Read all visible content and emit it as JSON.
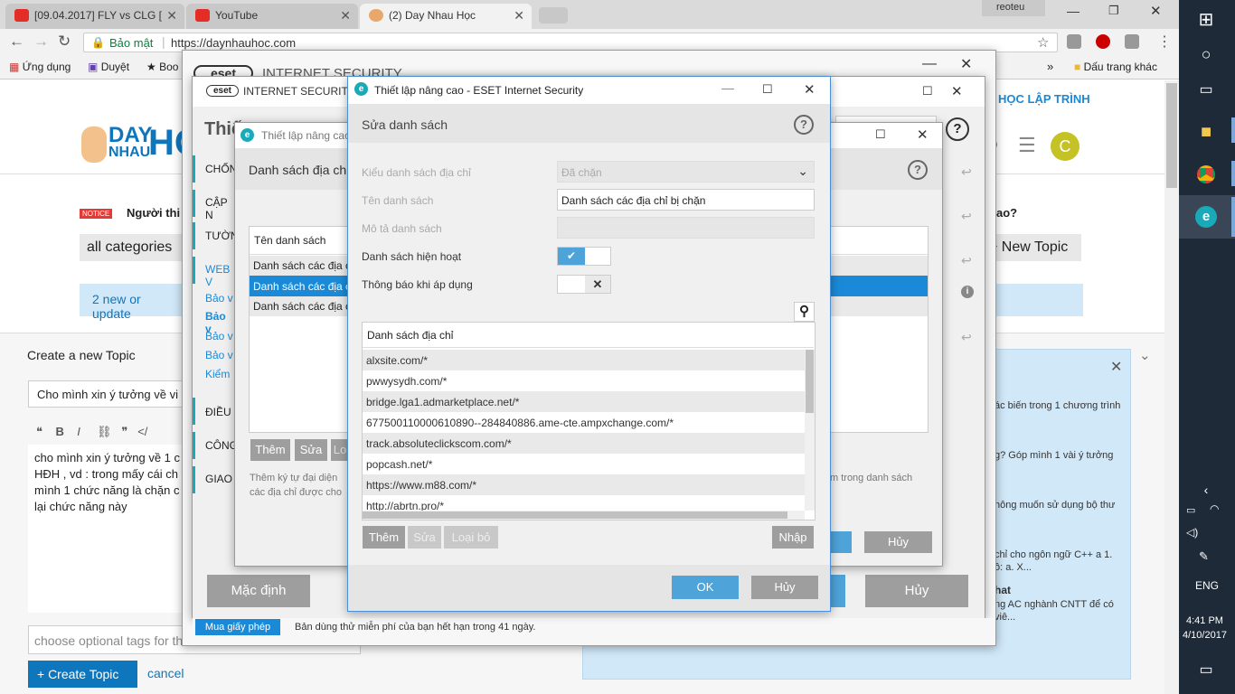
{
  "browser": {
    "tabs": [
      {
        "title": "[09.04.2017] FLY vs CLG ["
      },
      {
        "title": "YouTube"
      },
      {
        "title": "(2) Day Nhau Học"
      }
    ],
    "profile": "reoteu",
    "security_label": "Bảo mật",
    "url": "https://daynhauhoc.com",
    "bookmarks": [
      "Ứng dụng",
      "Duyệt",
      "Boo"
    ],
    "bookmarks_more": "»",
    "other_bookmarks": "Dấu trang khác"
  },
  "site": {
    "logo_top": "DAY",
    "logo_bottom": "NHAU",
    "logo_ho": "HO",
    "nav_right": "HỌC LẬP TRÌNH",
    "notice_badge": "NOTICE",
    "notice_text": "Người thi",
    "question_tail": "ao?",
    "category": "all categories",
    "new_topic": "+ New Topic",
    "new_updates": "2 new or update",
    "avatar_letter": "C",
    "composer": {
      "title": "Create a new Topic",
      "topic_value": "Cho mình xin ý tưởng về vi",
      "body_lines": [
        "cho mình xin ý tưởng về 1 c",
        "HĐH , vd : trong mấy cái ch",
        "mình 1 chức năng là chặn c",
        "lại chức năng này"
      ],
      "tags_placeholder": "choose optional tags for th",
      "create_btn": "+ Create Topic",
      "cancel": "cancel"
    },
    "sidebar_items": [
      "ác biến trong 1 chương trình",
      "g? Góp mình 1 vài ý tưởng",
      "hông muốn sử dụng bộ thư",
      "chỉ cho ngôn ngữ C++ a 1.",
      "ồ: a. X...",
      "hat",
      "ng AC nghành CNTT để có",
      "viê..."
    ]
  },
  "eset_main": {
    "logo": "eset",
    "product": "INTERNET SECURITY",
    "heading": "Thiế",
    "sections": [
      "CHỐN",
      "CẬP N",
      "TƯỜN",
      "WEB V",
      "Bảo v",
      "Bảo v",
      "Bảo v",
      "Bảo v",
      "Kiểm",
      "ĐIỀU",
      "CÔNG",
      "GIAO"
    ],
    "default_btn": "Mặc định",
    "cancel_btn": "Hủy",
    "buy_btn": "Mua giấy phép",
    "trial_text": "Bản dùng thử miễn phí của bạn hết hạn trong 41 ngày."
  },
  "eset_mid": {
    "title": "Thiết lập nâng cao",
    "heading": "Danh sách địa ch",
    "column": "Tên danh sách",
    "rows": [
      "Danh sách các địa c",
      "Danh sách các địa c",
      "Danh sách các địa c"
    ],
    "buttons": [
      "Thêm",
      "Sửa",
      "Lo"
    ],
    "desc1": "Thêm ký tự đại diện",
    "desc2": "các địa chỉ được cho",
    "desc_right": "m trong danh sách",
    "cancel": "Hủy"
  },
  "dialog": {
    "title": "Thiết lập nâng cao - ESET Internet Security",
    "heading": "Sửa danh sách",
    "help": "?",
    "fields": {
      "type_label": "Kiểu danh sách địa chỉ",
      "type_value": "Đã chặn",
      "name_label": "Tên danh sách",
      "name_value": "Danh sách các địa chỉ bị chặn",
      "desc_label": "Mô tả danh sách",
      "desc_value": "",
      "active_label": "Danh sách hiện hoạt",
      "notify_label": "Thông báo khi áp dụng"
    },
    "toggles": {
      "active": true,
      "notify": false
    },
    "list_header": "Danh sách địa chỉ",
    "addresses": [
      "alxsite.com/*",
      "pwwysydh.com/*",
      "bridge.lga1.admarketplace.net/*",
      "677500110000610890--284840886.ame-cte.ampxchange.com/*",
      "track.absoluteclickscom.com/*",
      "popcash.net/*",
      "https://www.m88.com/*",
      "http://abrtn.pro/*"
    ],
    "list_buttons": [
      "Thêm",
      "Sửa",
      "Loại bỏ"
    ],
    "import": "Nhập",
    "ok": "OK",
    "cancel": "Hủy"
  },
  "taskbar": {
    "lang": "ENG",
    "time": "4:41 PM",
    "date": "4/10/2017"
  },
  "colors": {
    "eset_teal": "#1aa9b8",
    "accent_blue": "#4ea3d8",
    "site_blue": "#0e76bd",
    "taskbar": "#1f2a38"
  }
}
